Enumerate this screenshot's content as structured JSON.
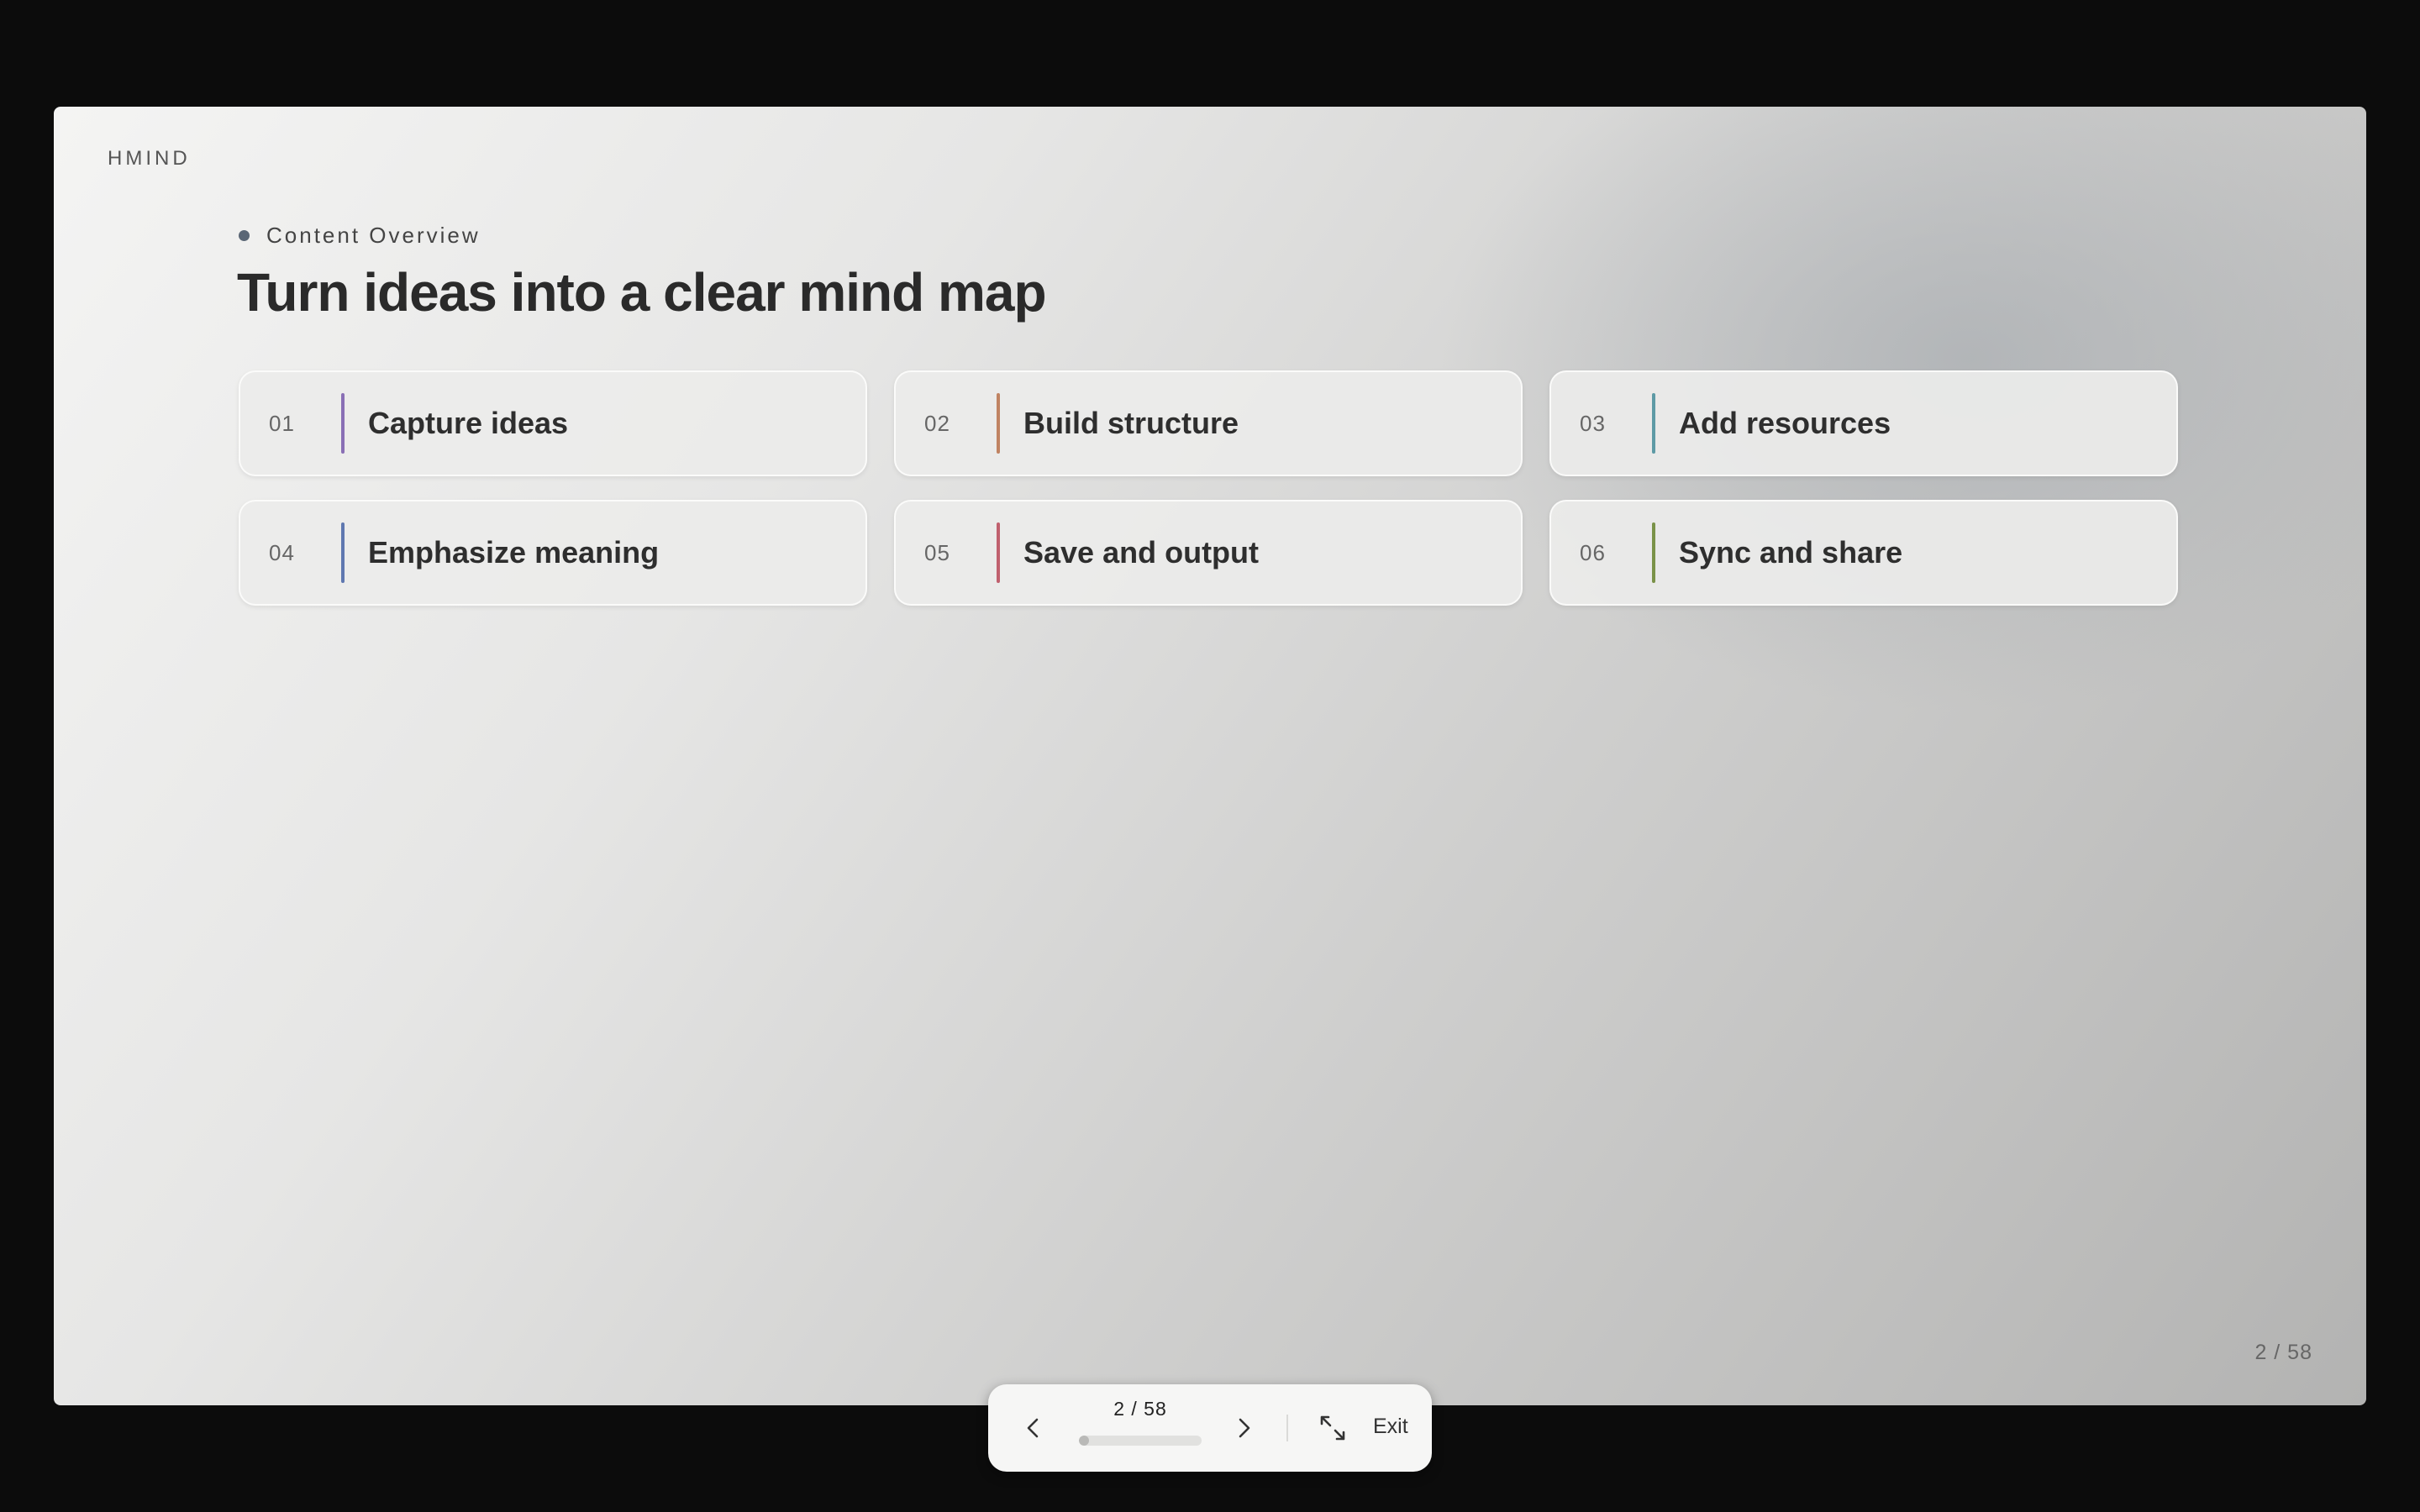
{
  "slide": {
    "brand": "HMIND",
    "section_label": "Content Overview",
    "section_dot_color": "#5a6675",
    "title": "Turn ideas into a clear mind map",
    "cards": [
      {
        "number": "01",
        "label": "Capture ideas",
        "accent": "#8a6fb5"
      },
      {
        "number": "02",
        "label": "Build structure",
        "accent": "#c08362"
      },
      {
        "number": "03",
        "label": "Add resources",
        "accent": "#5d9aa5"
      },
      {
        "number": "04",
        "label": "Emphasize meaning",
        "accent": "#5f78b0"
      },
      {
        "number": "05",
        "label": "Save and output",
        "accent": "#c0606e"
      },
      {
        "number": "06",
        "label": "Sync and share",
        "accent": "#7a9248"
      }
    ],
    "page_indicator": "2 / 58"
  },
  "controls": {
    "counter": "2 / 58",
    "current_page": 2,
    "total_pages": 58,
    "prev_icon": "chevron-left-icon",
    "next_icon": "chevron-right-icon",
    "fullscreen_icon": "expand-arrows-icon",
    "exit_label": "Exit"
  }
}
